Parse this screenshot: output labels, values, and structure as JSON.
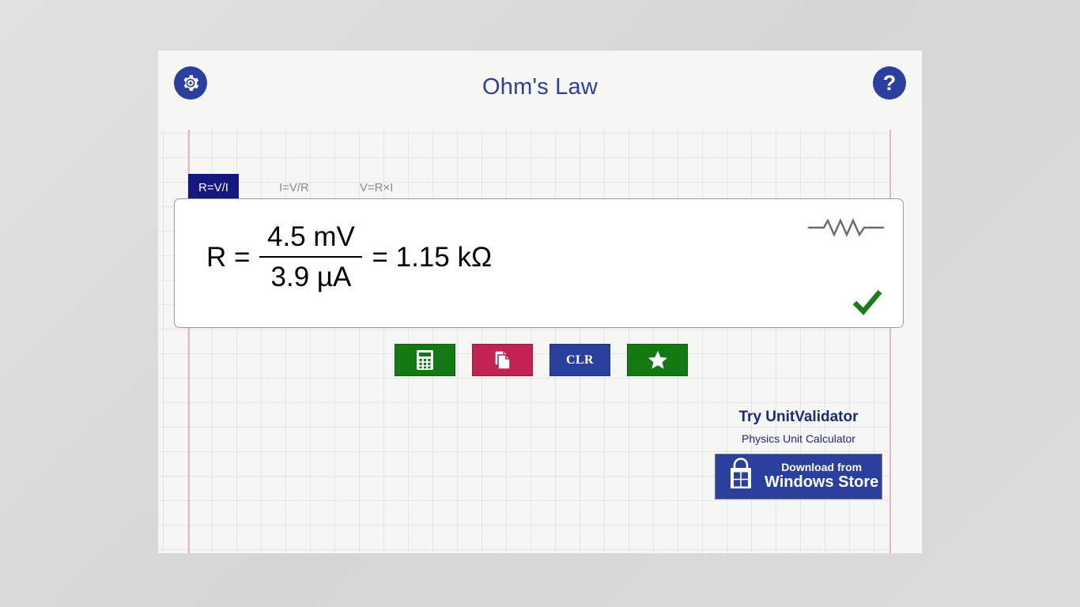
{
  "window": {
    "title": "Ohm's Law"
  },
  "header": {
    "title": "Ohm's Law",
    "settings_icon": "gear-icon",
    "help_icon": "question-mark-icon",
    "help_label": "?"
  },
  "tabs": [
    {
      "label": "R=V/I",
      "active": true
    },
    {
      "label": "I=V/R",
      "active": false
    },
    {
      "label": "V=R×I",
      "active": false
    }
  ],
  "formula": {
    "result_variable": "R",
    "equals_1": "=",
    "numerator": "4.5 mV",
    "denominator": "3.9 µA",
    "equals_2": "=",
    "result": "1.15 kΩ",
    "lhs_text": "R  =",
    "rhs_text": "=  1.15 kΩ",
    "symbol_icon": "resistor-symbol-icon",
    "status_icon": "check-mark-icon",
    "status_color": "#1a7d1a"
  },
  "actions": [
    {
      "name": "calculate-button",
      "icon": "calculator-icon",
      "label": "",
      "color": "#137a13"
    },
    {
      "name": "copy-button",
      "icon": "copy-pages-icon",
      "label": "",
      "color": "#c32352"
    },
    {
      "name": "clear-button",
      "icon": "",
      "label": "CLR",
      "color": "#2b3f9e"
    },
    {
      "name": "favorite-button",
      "icon": "star-icon",
      "label": "",
      "color": "#137a13"
    }
  ],
  "promo": {
    "title": "Try UnitValidator",
    "subtitle": "Physics Unit Calculator",
    "badge_small": "Download from",
    "badge_big": "Windows Store",
    "badge_icon": "windows-store-bag-icon"
  },
  "colors": {
    "brand_navy": "#2b3f9e",
    "tab_active": "#12187e",
    "green": "#137a13",
    "crimson": "#c32352",
    "paper": "#f6f6f4",
    "margin_line": "#e2b9bf"
  }
}
